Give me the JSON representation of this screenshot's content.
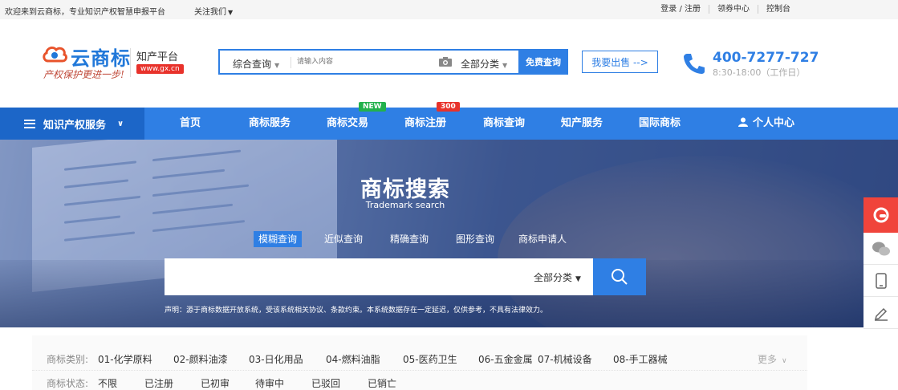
{
  "topbar": {
    "welcome": "欢迎来到云商标，专业知识产权智慧申报平台",
    "follow": "关注我们",
    "links": [
      "登录 / 注册",
      "领券中心",
      "控制台"
    ]
  },
  "header": {
    "logo_text": "云商标",
    "slogan": "产权保护更进一步!",
    "platform": "知产平台",
    "platform_url": "www.gx.cn",
    "search_type": "综合查询",
    "search_placeholder": "请输入内容",
    "search_category": "全部分类",
    "search_button": "免费查询",
    "sell_button": "我要出售 -->",
    "phone": "400-7277-727",
    "hours": "8:30-18:00（工作日）"
  },
  "nav": {
    "all_label": "知识产权服务",
    "items": [
      "首页",
      "商标服务",
      "商标交易",
      "商标注册",
      "商标查询",
      "知产服务",
      "国际商标",
      "个人中心"
    ],
    "badge_new": "NEW",
    "badge_300": "300"
  },
  "banner": {
    "title": "商标搜索",
    "subtitle": "Trademark search",
    "tabs": [
      "模糊查询",
      "近似查询",
      "精确查询",
      "图形查询",
      "商标申请人"
    ],
    "category": "全部分类",
    "note": "声明：源于商标数据开放系统，受该系统相关协议、条款约束。本系统数据存在一定延迟，仅供参考，不具有法律效力。"
  },
  "filters": {
    "category_label": "商标类别:",
    "categories": [
      "01-化学原料",
      "02-颜料油漆",
      "03-日化用品",
      "04-燃料油脂",
      "05-医药卫生",
      "06-五金金属",
      "07-机械设备",
      "08-手工器械"
    ],
    "more": "更多",
    "status_label": "商标状态:",
    "statuses": [
      "不限",
      "已注册",
      "已初审",
      "待审中",
      "已驳回",
      "已销亡"
    ]
  },
  "colors": {
    "primary": "#2f7fe4",
    "nav_dark": "#1c66c8",
    "accent_red": "#e8322b",
    "badge_green": "#22b14c"
  }
}
